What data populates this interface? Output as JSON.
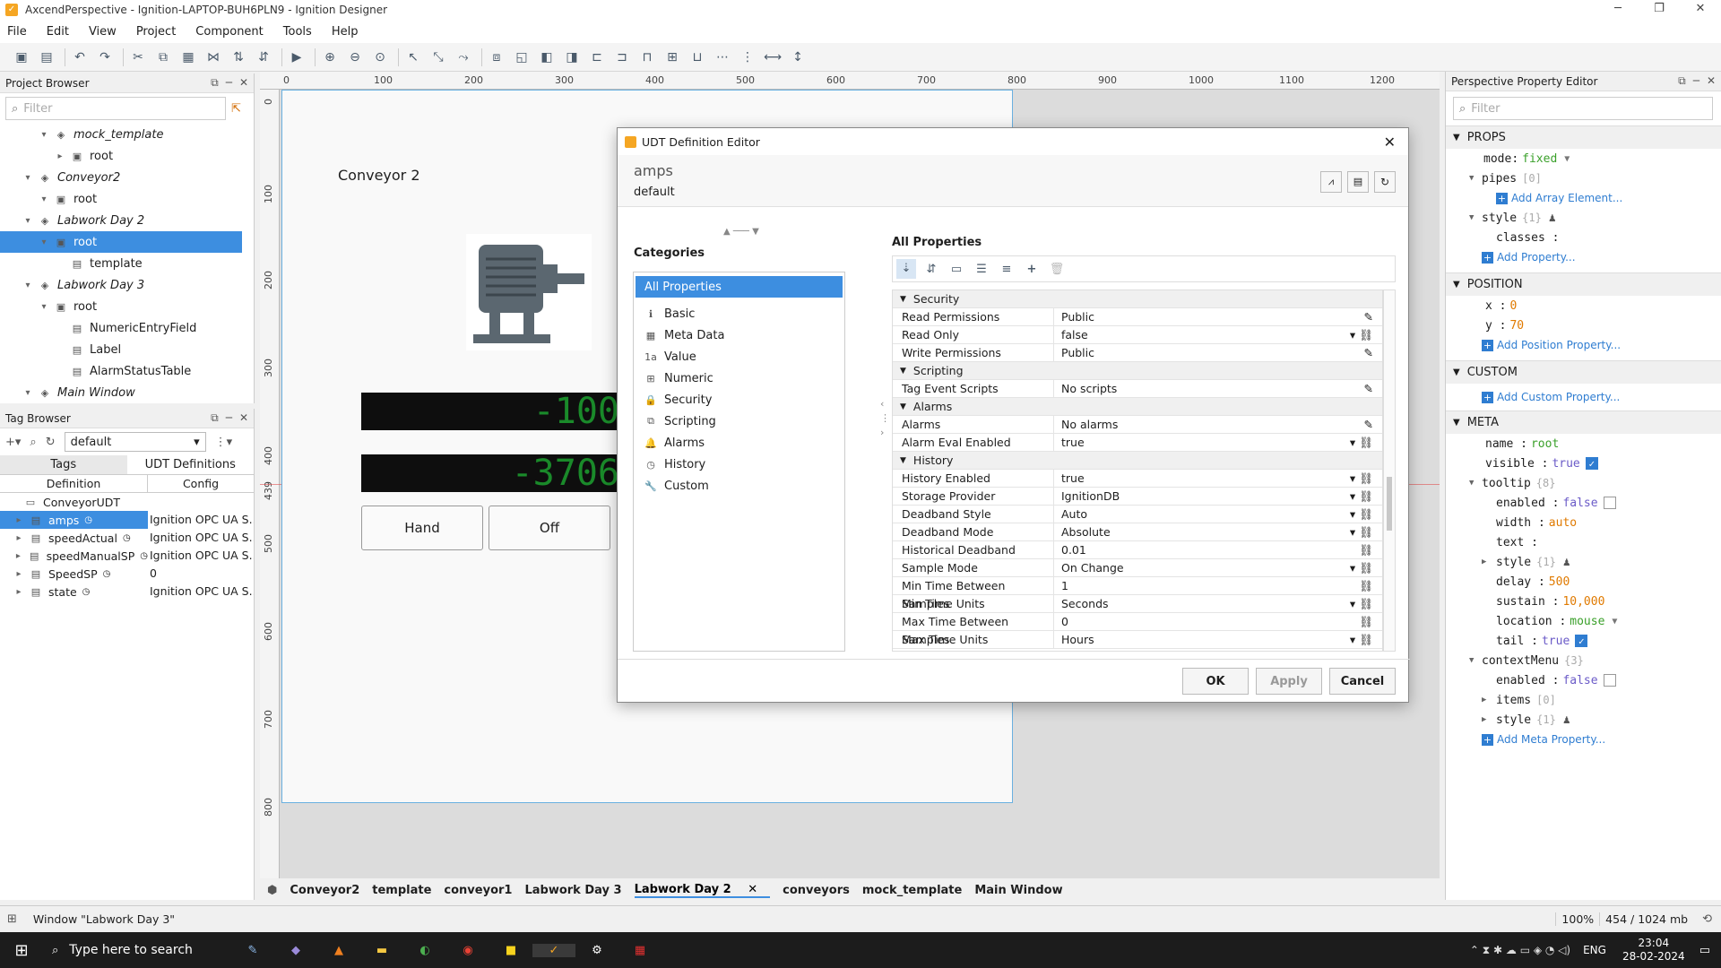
{
  "window": {
    "title": "AxcendPerspective - Ignition-LAPTOP-BUH6PLN9 - Ignition Designer"
  },
  "menu": [
    "File",
    "Edit",
    "View",
    "Project",
    "Component",
    "Tools",
    "Help"
  ],
  "project_browser": {
    "title": "Project Browser",
    "filter_placeholder": "Filter",
    "items": [
      {
        "label": "mock_template",
        "level": 3,
        "italic": true
      },
      {
        "label": "root",
        "level": 4
      },
      {
        "label": "Conveyor2",
        "level": 2,
        "italic": true
      },
      {
        "label": "root",
        "level": 3
      },
      {
        "label": "Labwork Day 2",
        "level": 2,
        "italic": true
      },
      {
        "label": "root",
        "level": 3,
        "selected": true
      },
      {
        "label": "template",
        "level": 4
      },
      {
        "label": "Labwork Day 3",
        "level": 2,
        "italic": true
      },
      {
        "label": "root",
        "level": 3
      },
      {
        "label": "NumericEntryField",
        "level": 4
      },
      {
        "label": "Label",
        "level": 4
      },
      {
        "label": "AlarmStatusTable",
        "level": 4
      },
      {
        "label": "Main Window",
        "level": 2,
        "italic": true
      }
    ]
  },
  "tag_browser": {
    "title": "Tag Browser",
    "provider": "default",
    "tabs": [
      "Tags",
      "UDT Definitions"
    ],
    "columns": [
      "Definition",
      "Config"
    ],
    "rows": [
      {
        "name": "ConveyorUDT",
        "config": ""
      },
      {
        "name": "amps",
        "config": "Ignition OPC UA S...",
        "selected": true
      },
      {
        "name": "speedActual",
        "config": "Ignition OPC UA S..."
      },
      {
        "name": "speedManualSP",
        "config": "Ignition OPC UA S..."
      },
      {
        "name": "SpeedSP",
        "config": "0"
      },
      {
        "name": "state",
        "config": "Ignition OPC UA S..."
      }
    ]
  },
  "ruler": {
    "top": [
      "0",
      "100",
      "200",
      "300",
      "400",
      "500",
      "600",
      "700",
      "800",
      "900",
      "1000",
      "1100",
      "1200"
    ],
    "left": [
      "0",
      "100",
      "200",
      "300",
      "400",
      "439",
      "500",
      "600",
      "700",
      "800"
    ]
  },
  "view": {
    "label": "Conveyor 2",
    "display1": "-100",
    "display2": "-3706",
    "buttons": [
      "Hand",
      "Off"
    ]
  },
  "bottom_tabs": [
    "Conveyor2",
    "template",
    "conveyor1",
    "Labwork Day 3",
    "Labwork Day 2",
    "conveyors",
    "mock_template",
    "Main Window"
  ],
  "status": {
    "window": "Window \"Labwork Day 3\"",
    "zoom": "100%",
    "memory": "454 / 1024 mb"
  },
  "dialog": {
    "title": "UDT Definition Editor",
    "tag_name": "amps",
    "provider": "default",
    "categories_title": "Categories",
    "categories": [
      "All Properties",
      "Basic",
      "Meta Data",
      "Value",
      "Numeric",
      "Security",
      "Scripting",
      "Alarms",
      "History",
      "Custom"
    ],
    "props_title": "All Properties",
    "sections": [
      {
        "name": "Security",
        "rows": [
          [
            "Read Permissions",
            "Public"
          ],
          [
            "Read Only",
            "false"
          ],
          [
            "Write Permissions",
            "Public"
          ]
        ]
      },
      {
        "name": "Scripting",
        "rows": [
          [
            "Tag Event Scripts",
            "No scripts"
          ]
        ]
      },
      {
        "name": "Alarms",
        "rows": [
          [
            "Alarms",
            "No alarms"
          ],
          [
            "Alarm Eval Enabled",
            "true"
          ]
        ]
      },
      {
        "name": "History",
        "rows": [
          [
            "History Enabled",
            "true"
          ],
          [
            "Storage Provider",
            "IgnitionDB"
          ],
          [
            "Deadband Style",
            "Auto"
          ],
          [
            "Deadband Mode",
            "Absolute"
          ],
          [
            "Historical Deadband",
            "0.01"
          ],
          [
            "Sample Mode",
            "On Change"
          ],
          [
            "Min Time Between Samples",
            "1"
          ],
          [
            "Min Time Units",
            "Seconds"
          ],
          [
            "Max Time Between Samples",
            "0"
          ],
          [
            "Max Time Units",
            "Hours"
          ]
        ]
      }
    ],
    "buttons": {
      "ok": "OK",
      "apply": "Apply",
      "cancel": "Cancel"
    }
  },
  "prop_editor": {
    "title": "Perspective Property Editor",
    "filter_placeholder": "Filter",
    "props_label": "PROPS",
    "position_label": "POSITION",
    "custom_label": "CUSTOM",
    "meta_label": "META",
    "mode": "fixed",
    "pipes_count": "[0]",
    "style_count": "{1}",
    "add_array": "Add Array Element...",
    "add_property": "Add Property...",
    "x": "0",
    "y": "70",
    "add_position": "Add Position Property...",
    "add_custom": "Add Custom Property...",
    "name": "root",
    "visible": "true",
    "tooltip_count": "{8}",
    "tt_enabled": "false",
    "tt_width": "auto",
    "tt_delay": "500",
    "tt_sustain": "10,000",
    "tt_location": "mouse",
    "tt_tail": "true",
    "cm_count": "{3}",
    "cm_enabled": "false",
    "items_count": "[0]",
    "add_meta": "Add Meta Property..."
  },
  "taskbar": {
    "search": "Type here to search",
    "lang": "ENG",
    "time": "23:04",
    "date": "28-02-2024"
  }
}
